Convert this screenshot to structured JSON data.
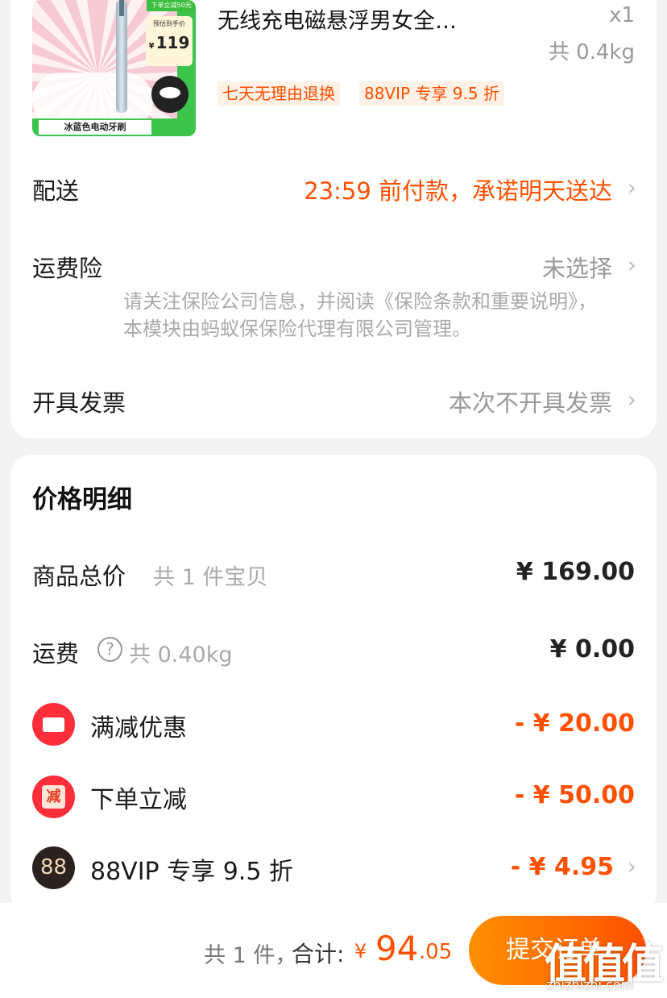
{
  "product": {
    "title": "无线充电磁悬浮男女全…",
    "quantity": "x1",
    "weight": "共 0.4kg",
    "tags": [
      "七天无理由退换",
      "88VIP 专享 9.5 折"
    ],
    "image": {
      "top_tag": "下单立减50元",
      "price_label": "预估到手价",
      "price_currency": "¥",
      "price": "119",
      "bottom_label": "冰蓝色电动牙刷"
    }
  },
  "rows": {
    "delivery": {
      "label": "配送",
      "value": "23:59 前付款，承诺明天送达"
    },
    "insurance": {
      "label": "运费险",
      "value": "未选择",
      "note": "请关注保险公司信息，并阅读《保险条款和重要说明》，本模块由蚂蚁保保险代理有限公司管理。"
    },
    "invoice": {
      "label": "开具发票",
      "value": "本次不开具发票"
    }
  },
  "price_detail": {
    "title": "价格明细",
    "goods_total": {
      "label": "商品总价",
      "sub": "共 1 件宝贝",
      "amount": "¥ 169.00"
    },
    "shipping": {
      "label": "运费",
      "sub": "共 0.40kg",
      "amount": "¥ 0.00"
    },
    "discounts": [
      {
        "icon": "coupon-icon",
        "label": "满减优惠",
        "amount": "- ¥ 20.00"
      },
      {
        "icon": "cut-icon",
        "icon_text": "减",
        "label": "下单立减",
        "amount": "- ¥ 50.00"
      },
      {
        "icon": "vip-icon",
        "icon_text": "88",
        "label": "88VIP 专享 9.5 折",
        "amount": "- ¥ 4.95"
      }
    ]
  },
  "bottom_bar": {
    "count": "共 1 件，",
    "total_label": "合计:",
    "currency": "¥",
    "total_int": "94",
    "total_dec": ".05",
    "submit": "提交订单"
  },
  "watermark": {
    "logo": "值值值",
    "url": "zhizhizhi.com"
  },
  "colors": {
    "accent": "#ff5000",
    "tag_bg": "#fff1e6",
    "red_icon": "#ff2e3b"
  }
}
